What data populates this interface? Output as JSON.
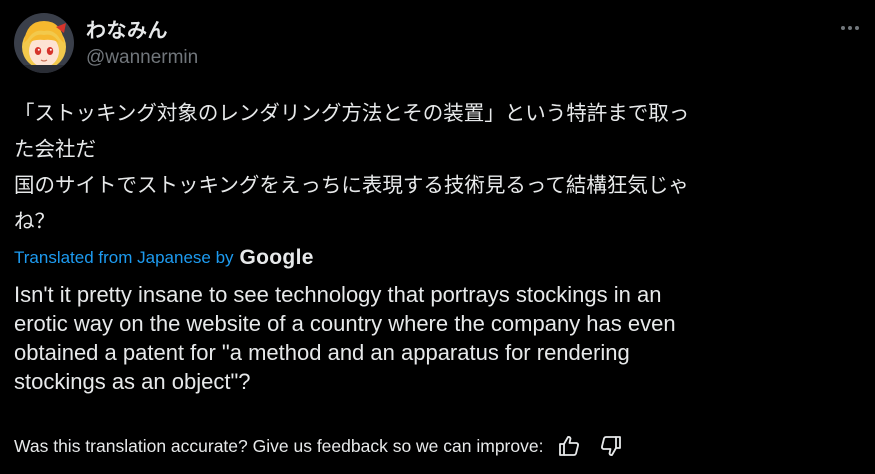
{
  "author": {
    "display_name": "わなみん",
    "handle": "@wannermin",
    "avatar_icon": "avatar-anime-girl"
  },
  "menu": {
    "icon": "more-horizontal-icon"
  },
  "original_text": {
    "lines": [
      "「ストッキング対象のレンダリング方法とその装置」という特許まで取っ",
      "た会社だ",
      "国のサイトでストッキングをえっちに表現する技術見るって結構狂気じゃ",
      "ね？"
    ]
  },
  "translation": {
    "label": "Translated from Japanese by",
    "provider": "Google",
    "lines": [
      "Isn't it pretty insane to see technology that portrays stockings in an",
      "erotic way on the website of a country where the company has even",
      "obtained a patent for \"a method and an apparatus for rendering",
      "stockings as an object\"?"
    ]
  },
  "feedback": {
    "prompt": "Was this translation accurate? Give us feedback so we can improve:",
    "thumbs_up_icon": "thumbs-up-icon",
    "thumbs_down_icon": "thumbs-down-icon"
  },
  "colors": {
    "background": "#000000",
    "text_primary": "#e7e9ea",
    "text_secondary": "#71767b",
    "link": "#1d9bf0"
  }
}
